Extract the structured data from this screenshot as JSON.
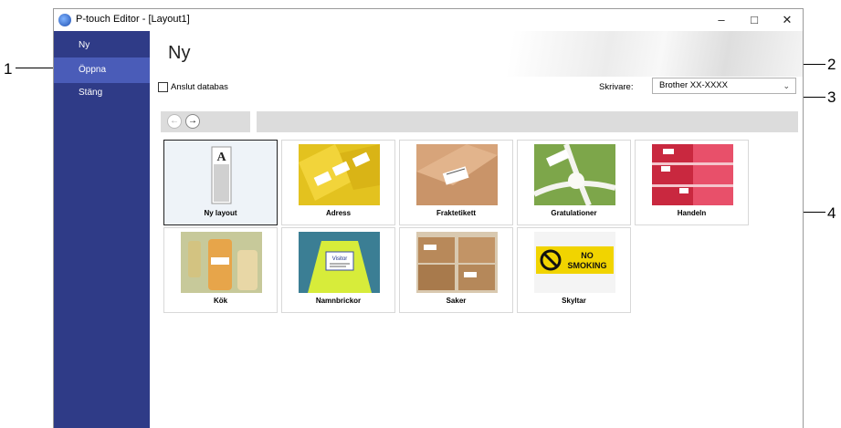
{
  "window": {
    "title": "P-touch Editor - [Layout1]",
    "controls": {
      "minimize": "–",
      "maximize": "□",
      "close": "✕"
    }
  },
  "sidebar": {
    "items": [
      {
        "label": "Ny",
        "selected": false
      },
      {
        "label": "Öppna",
        "selected": true
      },
      {
        "label": "Stäng",
        "selected": false
      }
    ]
  },
  "main": {
    "title": "Ny",
    "database_checkbox": {
      "label": "Anslut databas",
      "checked": false
    },
    "printer": {
      "label": "Skrivare:",
      "value": "Brother XX-XXXX"
    },
    "nav": {
      "back": "←",
      "forward": "→"
    },
    "templates": [
      {
        "label": "Ny layout",
        "selected": true
      },
      {
        "label": "Adress",
        "selected": false
      },
      {
        "label": "Fraktetikett",
        "selected": false
      },
      {
        "label": "Gratulationer",
        "selected": false
      },
      {
        "label": "Handeln",
        "selected": false
      },
      {
        "label": "Kök",
        "selected": false
      },
      {
        "label": "Namnbrickor",
        "selected": false
      },
      {
        "label": "Saker",
        "selected": false
      },
      {
        "label": "Skyltar",
        "selected": false
      }
    ]
  },
  "callouts": [
    "1",
    "2",
    "3",
    "4"
  ],
  "thumbnail_text": {
    "new_layout_letter": "A",
    "name_badge": "Visitor",
    "sign_line1": "NO",
    "sign_line2": "SMOKING"
  },
  "colors": {
    "sidebar": "#2f3b87",
    "sidebar_selected": "#4a5cb8",
    "selected_tile": "#eef3f8"
  }
}
